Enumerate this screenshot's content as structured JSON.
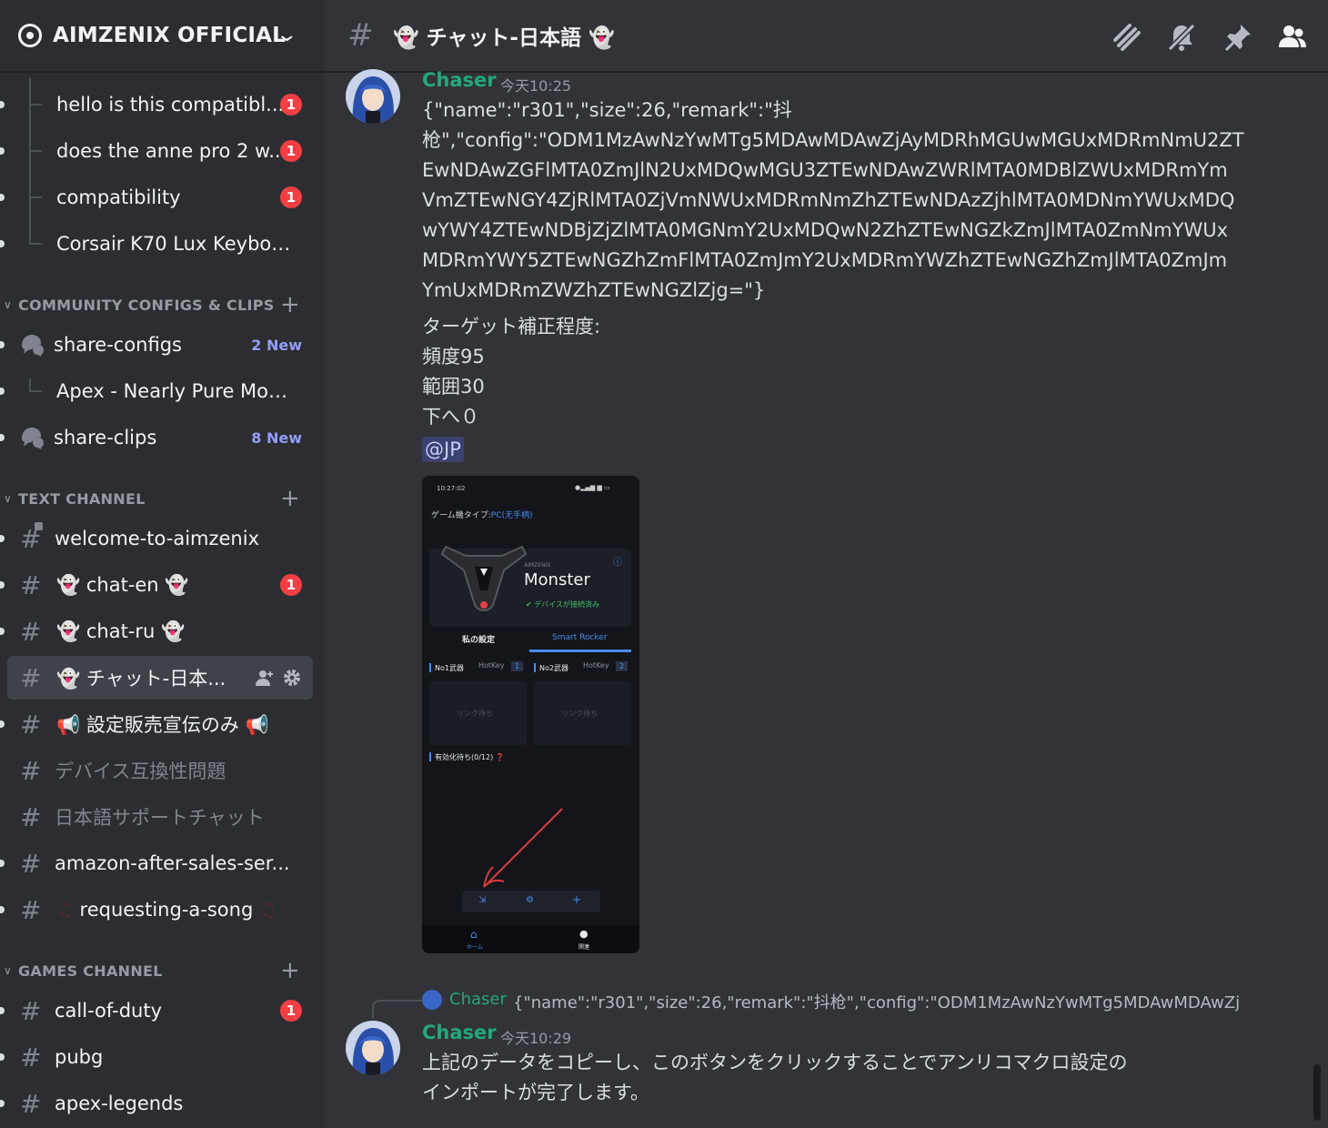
{
  "server": {
    "name": "AIMZENIX OFFICIAL"
  },
  "threads": [
    {
      "label": "hello is this compatibl...",
      "badge": "1"
    },
    {
      "label": "does the anne pro 2 w...",
      "badge": "1"
    },
    {
      "label": "compatibility",
      "badge": "1"
    },
    {
      "label": "Corsair K70 Lux Keyboa..."
    }
  ],
  "categories": {
    "community": "COMMUNITY CONFIGS & CLIPS",
    "text": "TEXT CHANNEL",
    "games": "GAMES CHANNEL"
  },
  "community_channels": {
    "share_configs": {
      "label": "share-configs",
      "new": "2 New"
    },
    "apex_thread": {
      "label": "Apex - Nearly Pure Mou..."
    },
    "share_clips": {
      "label": "share-clips",
      "new": "8 New"
    }
  },
  "text_channels": {
    "welcome": "welcome-to-aimzenix",
    "chat_en": "chat-en",
    "chat_en_badge": "1",
    "chat_ru": "chat-ru",
    "chat_jp": "チャット-日本...",
    "settings_sales": "設定販売宣伝のみ",
    "device_compat": "デバイス互換性問題",
    "jp_support": "日本語サポートチャット",
    "amazon": "amazon-after-sales-ser...",
    "song": "requesting-a-song"
  },
  "game_channels": {
    "cod": "call-of-duty",
    "cod_badge": "1",
    "pubg": "pubg",
    "apex": "apex-legends"
  },
  "topbar": {
    "title": "チャット-日本語"
  },
  "messages": [
    {
      "author": "Chaser",
      "time": "今天10:25",
      "lines": [
        "{\"name\":\"r301\",\"size\":26,\"remark\":\"抖",
        "枪\",\"config\":\"ODM1MzAwNzYwMTg5MDAwMDAwZjAyMDRhMGUwMGUxMDRmNmU2ZT",
        "EwNDAwZGFlMTA0ZmJlN2UxMDQwMGU3ZTEwNDAwZWRlMTA0MDBlZWUxMDRmYm",
        "VmZTEwNGY4ZjRlMTA0ZjVmNWUxMDRmNmZhZTEwNDAzZjhlMTA0MDNmYWUxMDQ",
        "wYWY4ZTEwNDBjZjZlMTA0MGNmY2UxMDQwN2ZhZTEwNGZkZmJlMTA0ZmNmYWUx",
        "MDRmYWY5ZTEwNGZhZmFlMTA0ZmJmY2UxMDRmYWZhZTEwNGZhZmJlMTA0ZmJm",
        "YmUxMDRmZWZhZTEwNGZlZjg=\"}"
      ],
      "extra": [
        "ターゲット補正程度:",
        "頻度95",
        "範囲30",
        "下へ０"
      ],
      "mention": "@JP"
    },
    {
      "reply_author": "Chaser",
      "reply_text": "{\"name\":\"r301\",\"size\":26,\"remark\":\"抖枪\",\"config\":\"ODM1MzAwNzYwMTg5MDAwMDAwZj...",
      "author": "Chaser",
      "time": "今天10:29",
      "lines": [
        "上記のデータをコピーし、このボタンをクリックすることでアンリコマクロ設定の",
        "インポートが完了します。"
      ]
    }
  ],
  "phone": {
    "status_time": "10:27:02",
    "device_type_label": "ゲーム機タイプ:",
    "device_type_value": "PC(无手柄)",
    "brand": "AIMZENIX",
    "device_name": "Monster",
    "connected": "デバイスが接続済み",
    "tab_my": "私の設定",
    "tab_smart": "Smart Rocker",
    "weapon1": "No1武器",
    "weapon2": "No2武器",
    "hotkey": "HotKey",
    "hotkey1": "1",
    "hotkey2": "2",
    "link_wait": "リンク待ち",
    "pending": "有効化待ち(0/12)",
    "nav_home": "ホーム",
    "nav_about": "関連"
  },
  "colors": {
    "accent": "#23a67f",
    "badge": "#f23f43",
    "mention": "#949cf7"
  }
}
